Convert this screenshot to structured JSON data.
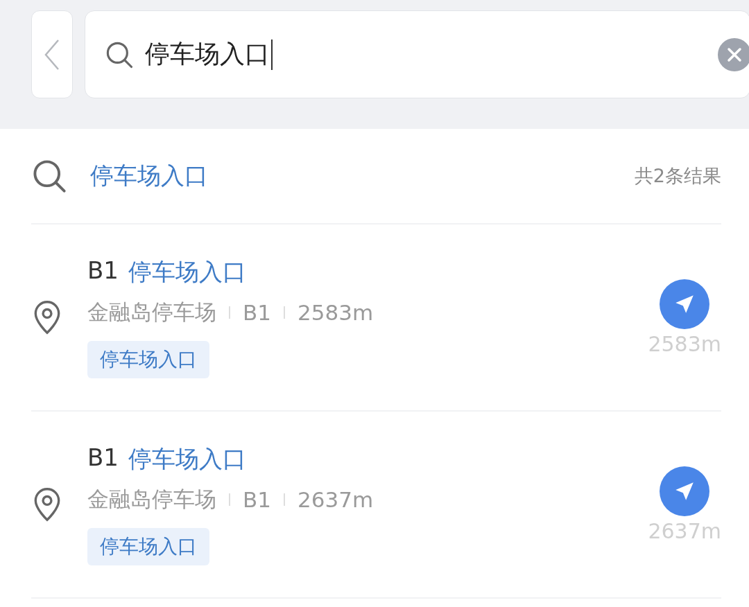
{
  "search_bar": {
    "value": "停车场入口"
  },
  "suggestion": {
    "query": "停车场入口",
    "count": "共2条结果"
  },
  "results": [
    {
      "level": "B1",
      "name": "停车场入口",
      "place": "金融岛停车场",
      "floor": "B1",
      "distance": "2583m",
      "tag": "停车场入口",
      "nav_distance": "2583m"
    },
    {
      "level": "B1",
      "name": "停车场入口",
      "place": "金融岛停车场",
      "floor": "B1",
      "distance": "2637m",
      "tag": "停车场入口",
      "nav_distance": "2637m"
    }
  ]
}
